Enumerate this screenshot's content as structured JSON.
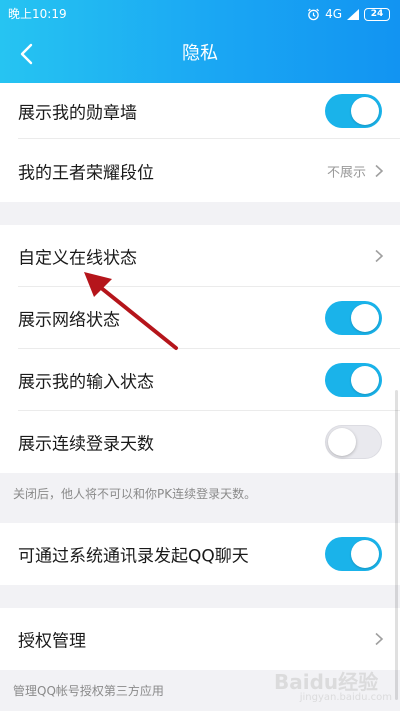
{
  "status_bar": {
    "time": "晚上10:19",
    "network": "4G",
    "battery": "24"
  },
  "nav": {
    "title": "隐私"
  },
  "settings": [
    {
      "label": "展示我的勋章墙",
      "control": "toggle",
      "on": true
    },
    {
      "label": "我的王者荣耀段位",
      "control": "value",
      "value": "不展示"
    },
    {
      "label": "自定义在线状态",
      "control": "chevron"
    },
    {
      "label": "展示网络状态",
      "control": "toggle",
      "on": true
    },
    {
      "label": "展示我的输入状态",
      "control": "toggle",
      "on": true
    },
    {
      "label": "展示连续登录天数",
      "control": "toggle",
      "on": false
    },
    {
      "label": "可通过系统通讯录发起QQ聊天",
      "control": "toggle",
      "on": true
    },
    {
      "label": "授权管理",
      "control": "chevron"
    }
  ],
  "notes": {
    "login_days": "关闭后，他人将不可以和你PK连续登录天数。",
    "authorization": "管理QQ帐号授权第三方应用"
  },
  "watermark": {
    "brand": "Baidu经验",
    "sub": "jingyan.baidu.com"
  },
  "colors": {
    "header_start": "#26c4f2",
    "header_end": "#1294f2",
    "toggle_on": "#1ab3ea",
    "annotation_arrow": "#b5151b"
  }
}
